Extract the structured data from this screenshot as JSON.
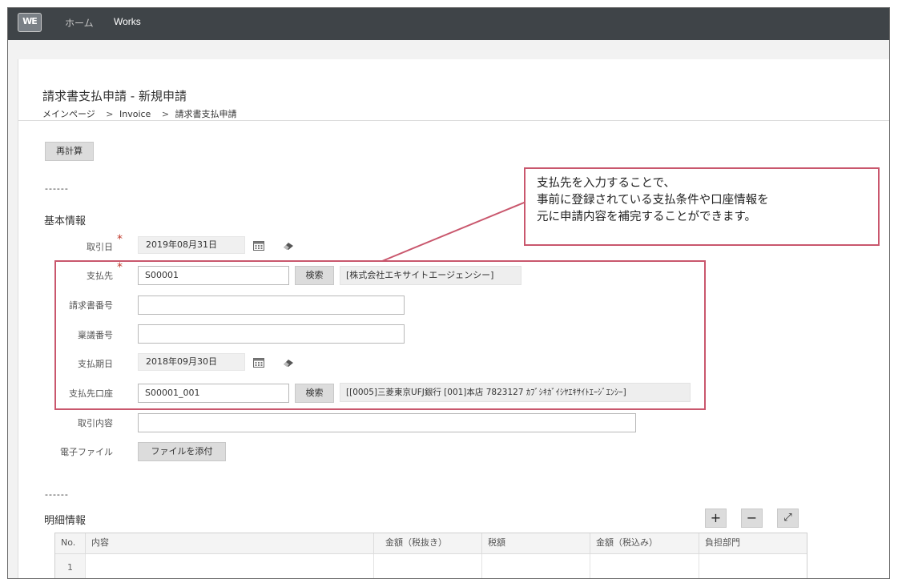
{
  "nav": {
    "logo": "WE",
    "home": "ホーム",
    "works": "Works"
  },
  "page": {
    "title": "請求書支払申請 - 新規申請",
    "breadcrumb": [
      "メインページ",
      "Invoice",
      "請求書支払申請"
    ],
    "breadcrumb_separator": ">"
  },
  "toolbar": {
    "recalc_label": "再計算"
  },
  "divider": "------",
  "basic": {
    "section_title": "基本情報",
    "trade_date": {
      "label": "取引日",
      "value": "2019年08月31日"
    },
    "payee": {
      "label": "支払先",
      "value": "S00001",
      "search_label": "検索",
      "name": "[株式会社エキサイトエージェンシー]"
    },
    "invoice_no": {
      "label": "請求書番号",
      "value": ""
    },
    "approval_no": {
      "label": "稟議番号",
      "value": ""
    },
    "due_date": {
      "label": "支払期日",
      "value": "2018年09月30日"
    },
    "account": {
      "label": "支払先口座",
      "value": "S00001_001",
      "search_label": "検索",
      "detail": "[[0005]三菱東京UFJ銀行 [001]本店 7823127 ｶﾌﾞｼｷｶﾞｲｼﾔｴｷｻｲﾄｴｰｼﾞｴﾝｼｰ]"
    },
    "content": {
      "label": "取引内容",
      "value": ""
    },
    "file": {
      "label": "電子ファイル",
      "button_label": "ファイルを添付"
    },
    "required_mark": "*"
  },
  "callout": {
    "lines": [
      "支払先を入力することで、",
      "事前に登録されている支払条件や口座情報を",
      "元に申請内容を補完することができます。"
    ]
  },
  "details": {
    "divider": "------",
    "section_title": "明細情報",
    "add_label": "+",
    "remove_label": "−",
    "expand_label": "⤢",
    "columns": [
      "No.",
      "内容",
      "金額（税抜き）",
      "税額",
      "金額（税込み）",
      "負担部門"
    ],
    "rows": [
      {
        "no": "1"
      }
    ]
  },
  "colors": {
    "nav_bg": "#3f4448",
    "highlight": "#c9576d",
    "required": "#c0392b"
  }
}
